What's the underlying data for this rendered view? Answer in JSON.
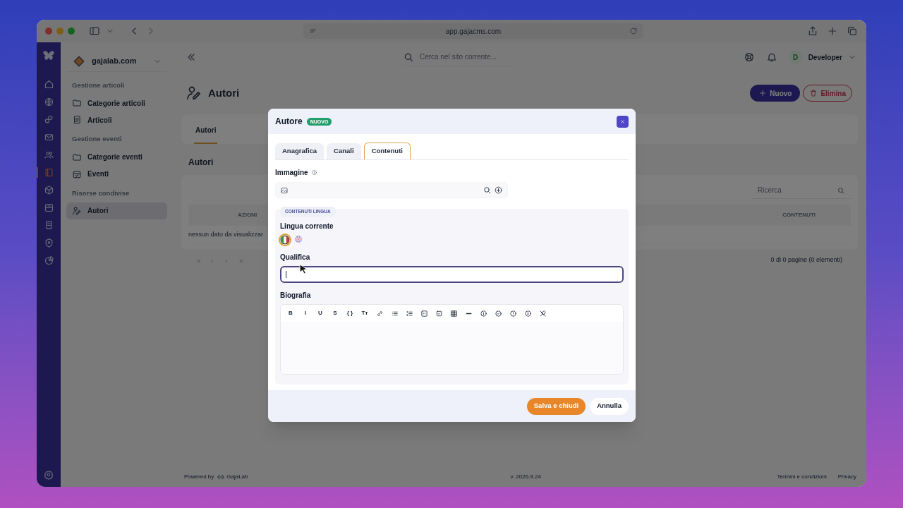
{
  "browser": {
    "url": "app.gajacms.com"
  },
  "rail": [
    {
      "kind": "home",
      "selected": false
    },
    {
      "kind": "globe",
      "selected": false
    },
    {
      "kind": "share",
      "selected": false
    },
    {
      "kind": "mail",
      "selected": false
    },
    {
      "kind": "users",
      "selected": false
    },
    {
      "kind": "book",
      "selected": true
    },
    {
      "kind": "cube",
      "selected": false
    },
    {
      "kind": "archive",
      "selected": false
    },
    {
      "kind": "document",
      "selected": false
    },
    {
      "kind": "shield",
      "selected": false
    },
    {
      "kind": "chart",
      "selected": false
    }
  ],
  "sidebar": {
    "site": "gajalab.com",
    "sections": [
      {
        "title": "Gestione articoli",
        "items": [
          {
            "label": "Categorie articoli",
            "kind": "folder",
            "selected": false
          },
          {
            "label": "Articoli",
            "kind": "document",
            "selected": false
          }
        ]
      },
      {
        "title": "Gestione eventi",
        "items": [
          {
            "label": "Categorie eventi",
            "kind": "folder",
            "selected": false
          },
          {
            "label": "Eventi",
            "kind": "calendar",
            "selected": false
          }
        ]
      },
      {
        "title": "Risorse condivise",
        "items": [
          {
            "label": "Autori",
            "kind": "author",
            "selected": true
          }
        ]
      }
    ]
  },
  "topbar": {
    "search_placeholder": "Cerca nel sito corrente...",
    "user_initial": "D",
    "user_name": "Developer"
  },
  "page": {
    "title": "Autori",
    "buttons": [
      {
        "label": "Nuovo",
        "kind": "primary"
      },
      {
        "label": "Elimina",
        "kind": "danger"
      }
    ],
    "tabs": [
      {
        "label": "Autori",
        "selected": true
      }
    ],
    "section_title": "Autori",
    "table": {
      "search_placeholder": "Ricerca",
      "columns": [
        "AZIONI",
        "CONTENUTI"
      ],
      "empty_text": "nessun dato da visualizzar",
      "pager": [
        "«",
        "‹",
        "›",
        "»"
      ],
      "summary": "0 di 0 pagine (0 elementi)"
    }
  },
  "footer": {
    "powered_by": "Powered by",
    "brand": "GajaLab",
    "version": "v. 2026.9.24",
    "links": [
      "Termini e condizioni",
      "Privacy"
    ]
  },
  "modal": {
    "title": "Autore",
    "badge": "NUOVO",
    "tabs": [
      {
        "label": "Anagrafica",
        "selected": false
      },
      {
        "label": "Canali",
        "selected": false
      },
      {
        "label": "Contenuti",
        "selected": true
      }
    ],
    "image_label": "Immagine",
    "group_legend": "CONTENUTI LINGUA",
    "language_label": "Lingua corrente",
    "languages": [
      {
        "kind": "it",
        "selected": true
      },
      {
        "kind": "uk",
        "selected": false
      }
    ],
    "qualifica_label": "Qualifica",
    "qualifica_focused": true,
    "bio_label": "Biografia",
    "toolbar": [
      {
        "kind": "glyph",
        "label": "B"
      },
      {
        "kind": "glyph",
        "label": "I"
      },
      {
        "kind": "glyph",
        "label": "U"
      },
      {
        "kind": "glyph",
        "label": "S"
      },
      {
        "kind": "glyph",
        "label": "{ }"
      },
      {
        "kind": "glyph",
        "label": "Tт"
      },
      {
        "kind": "link"
      },
      {
        "kind": "bullets"
      },
      {
        "kind": "numbers"
      },
      {
        "kind": "quote"
      },
      {
        "kind": "checkbox"
      },
      {
        "kind": "table"
      },
      {
        "kind": "rule"
      },
      {
        "kind": "info"
      },
      {
        "kind": "check"
      },
      {
        "kind": "warning"
      },
      {
        "kind": "cross"
      },
      {
        "kind": "clear"
      }
    ],
    "buttons": [
      {
        "label": "Salva e chiudi",
        "kind": "primary"
      },
      {
        "label": "Annulla",
        "kind": "secondary"
      }
    ]
  }
}
